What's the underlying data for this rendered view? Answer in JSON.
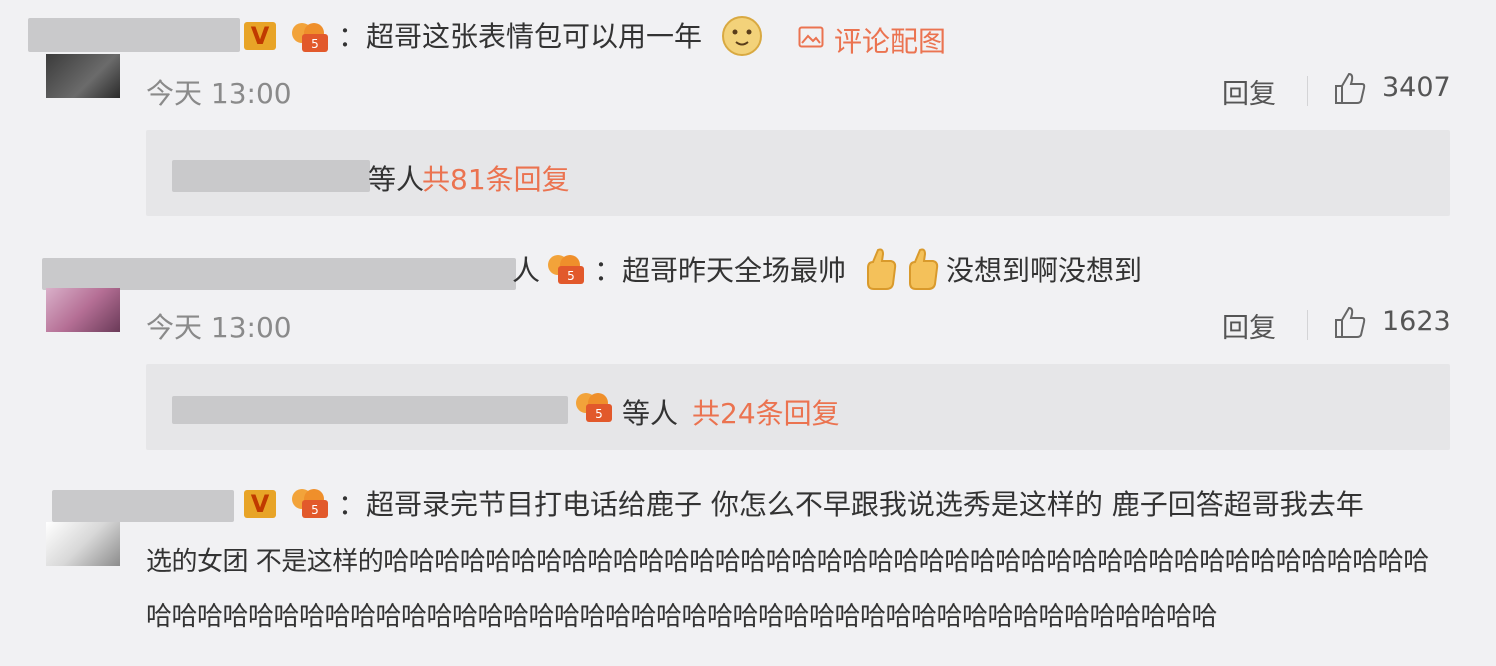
{
  "comments": [
    {
      "text": "：超哥这张表情包可以用一年",
      "tail_label": "评论配图",
      "time": "今天 13:00",
      "reply_label": "回复",
      "likes": "3407",
      "replies": {
        "suffix": "等人",
        "count": "共81条回复"
      }
    },
    {
      "name_tail": "人",
      "text": "：超哥昨天全场最帅",
      "text_after": "没想到啊没想到",
      "time": "今天 13:00",
      "reply_label": "回复",
      "likes": "1623",
      "replies": {
        "suffix": "等人",
        "count": "共24条回复"
      }
    },
    {
      "line1": "：超哥录完节目打电话给鹿子 你怎么不早跟我说选秀是这样的 鹿子回答超哥我去年",
      "line2": "选的女团 不是这样的哈哈哈哈哈哈哈哈哈哈哈哈哈哈哈哈哈哈哈哈哈哈哈哈哈哈哈哈哈哈哈哈哈哈哈哈哈哈哈哈哈",
      "line3": "哈哈哈哈哈哈哈哈哈哈哈哈哈哈哈哈哈哈哈哈哈哈哈哈哈哈哈哈哈哈哈哈哈哈哈哈哈哈哈哈哈哈"
    }
  ],
  "colors": {
    "accent": "#eb7350",
    "background": "#f1f1f3"
  },
  "icons": [
    "vip-v-icon",
    "fan-badge-icon",
    "doge-emoji-icon",
    "image-icon",
    "thumbs-up-icon"
  ]
}
